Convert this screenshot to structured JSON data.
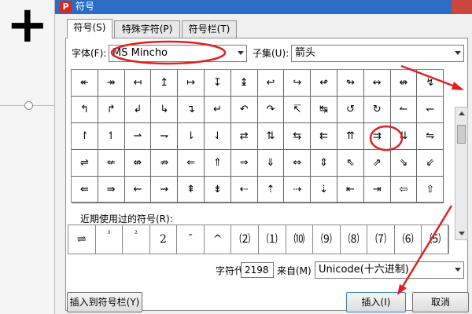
{
  "window": {
    "title": "符号",
    "logo": "P"
  },
  "tabs": [
    {
      "label": "符号(S)"
    },
    {
      "label": "特殊字符(P)"
    },
    {
      "label": "符号栏(T)"
    }
  ],
  "font": {
    "label": "字体(F):",
    "value": "MS Mincho"
  },
  "subset": {
    "label": "子集(U):",
    "value": "箭头"
  },
  "symbols": [
    [
      "↞",
      "↠",
      "↤",
      "↥",
      "↦",
      "↧",
      "↨",
      "↩",
      "↪",
      "↫",
      "↬",
      "↭",
      "↮",
      "↯"
    ],
    [
      "↰",
      "↱",
      "↲",
      "↳",
      "↴",
      "↵",
      "↶",
      "↷",
      "↸",
      "↹",
      "↺",
      "↻",
      "↼",
      "↽"
    ],
    [
      "↾",
      "↿",
      "⇀",
      "⇁",
      "⇂",
      "⇃",
      "⇄",
      "⇅",
      "⇆",
      "⇇",
      "⇈",
      "⇉",
      "⇊",
      "⇋"
    ],
    [
      "⇌",
      "⇍",
      "⇎",
      "⇏",
      "⇐",
      "⇑",
      "⇒",
      "⇓",
      "⇔",
      "⇕",
      "⇖",
      "⇗",
      "⇘",
      "⇙"
    ],
    [
      "⇚",
      "⇛",
      "⇜",
      "⇝",
      "⇞",
      "⇟",
      "⇠",
      "⇡",
      "⇢",
      "⇣",
      "⇤",
      "⇥",
      "⇦",
      "⇧"
    ]
  ],
  "recent": {
    "label": "近期使用过的符号(R):",
    "items": [
      "⇌",
      "³",
      "²",
      "2",
      "¯",
      "^",
      "⑵",
      "⑴",
      "⑽",
      "⑼",
      "⑻",
      "⑺",
      "⑹",
      "⑸"
    ]
  },
  "charcode": {
    "label": "字符代码(C):",
    "value": "2198",
    "from_label": "来自(M)",
    "from_value": "Unicode(十六进制)"
  },
  "buttons": {
    "insert_to_bar": "插入到符号栏(Y)",
    "insert": "插入(I)",
    "cancel": "取消"
  },
  "colors": {
    "title_bar": "#2b6cc4",
    "annotation": "#e02020",
    "close": "#c9453d"
  }
}
